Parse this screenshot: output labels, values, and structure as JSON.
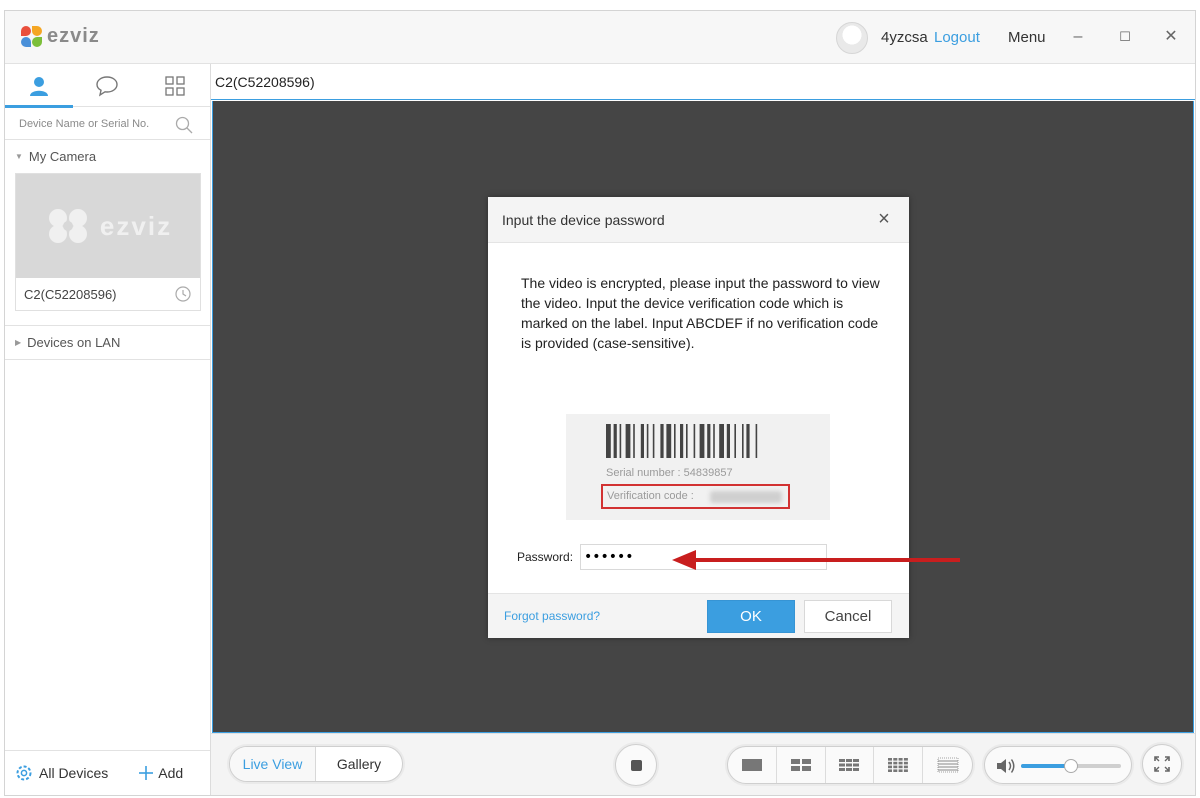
{
  "app": {
    "logo_text": "ezviz"
  },
  "titlebar": {
    "username": "4yzcsa",
    "logout": "Logout",
    "menu": "Menu",
    "minimize": "–",
    "maximize": "☐",
    "close": "✕"
  },
  "sidebar": {
    "search_placeholder": "Device Name or Serial No.",
    "my_camera": "My Camera",
    "camera_name": "C2(C52208596)",
    "thumb_watermark": "ezviz",
    "devices_on_lan": "Devices on LAN",
    "all_devices": "All Devices",
    "add": "Add"
  },
  "main": {
    "tab_label": "C2(C52208596)"
  },
  "dialog": {
    "title": "Input the device password",
    "message": "The video is encrypted, please input the password to view the video. Input the device verification code which is marked on the label. Input ABCDEF if no verification code is provided (case-sensitive).",
    "serial_text": "Serial number : 54839857",
    "verification_label": "Verification code :",
    "password_label": "Password:",
    "password_value": "abcdef",
    "forgot": "Forgot password?",
    "ok": "OK",
    "cancel": "Cancel"
  },
  "toolbar": {
    "live_view": "Live View",
    "gallery": "Gallery",
    "volume_level": 0.5
  },
  "colors": {
    "accent": "#3b9ee0",
    "video_bg": "#454545",
    "arrow": "#c81e1e",
    "highlight_box": "#d23232"
  }
}
